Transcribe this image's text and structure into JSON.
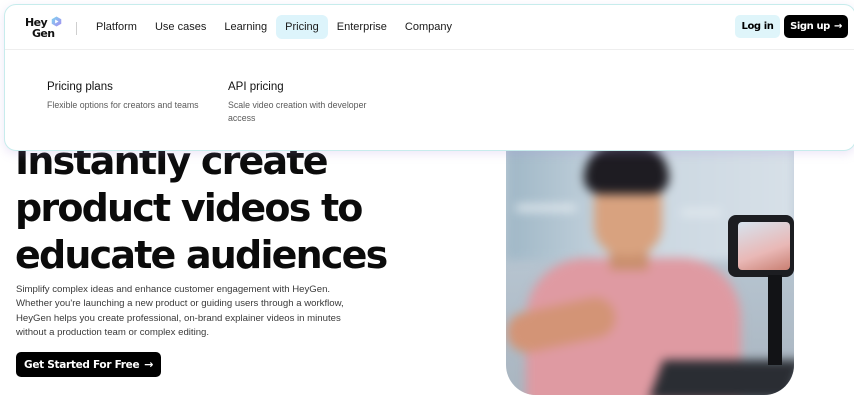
{
  "header": {
    "logo_line1": "Hey",
    "logo_line2": "Gen",
    "nav": [
      {
        "label": "Platform",
        "active": false
      },
      {
        "label": "Use cases",
        "active": false
      },
      {
        "label": "Learning",
        "active": false
      },
      {
        "label": "Pricing",
        "active": true
      },
      {
        "label": "Enterprise",
        "active": false
      },
      {
        "label": "Company",
        "active": false
      }
    ],
    "login_label": "Log in",
    "signup_label": "Sign up",
    "signup_icon": "arrow-right-icon"
  },
  "pricing_menu": {
    "items": [
      {
        "title": "Pricing plans",
        "description": "Flexible options for creators and teams"
      },
      {
        "title": "API pricing",
        "description": "Scale video creation with developer access"
      }
    ]
  },
  "hero": {
    "headline_lines": [
      "Instantly create",
      "product videos to",
      "educate audiences"
    ],
    "body": "Simplify complex ideas and enhance customer engagement with HeyGen. Whether you're launching a new product or guiding users through a workflow, HeyGen helps you create professional, on-brand explainer videos in minutes without a production team or complex editing.",
    "cta_label": "Get Started For Free",
    "cta_icon": "arrow-right-icon"
  },
  "colors": {
    "accent_active_tab": "#ddf4fb",
    "login_bg": "#dff5fa",
    "primary_button": "#000000"
  }
}
